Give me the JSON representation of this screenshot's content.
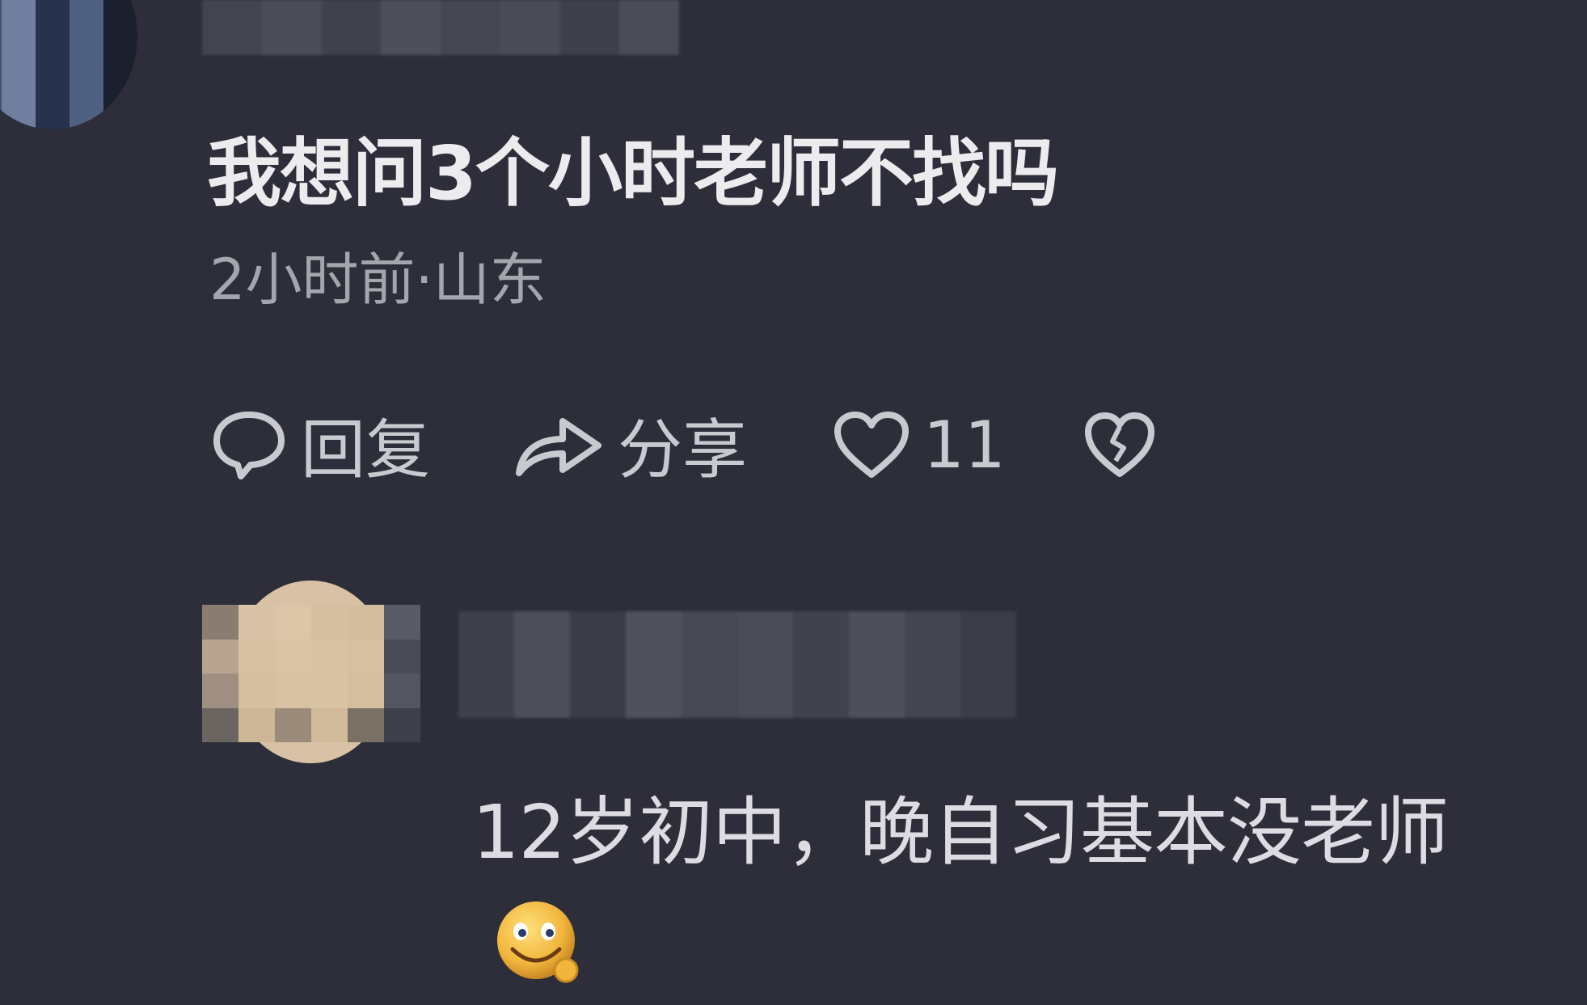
{
  "comment_1": {
    "text": "我想问3个小时老师不找吗",
    "meta": "2小时前·山东",
    "actions": {
      "reply_label": "回复",
      "share_label": "分享",
      "like_count": "11"
    }
  },
  "comment_2": {
    "text": "12岁初中，晚自习基本没老师",
    "emoji": "smiling-emoji"
  },
  "icons": {
    "reply": "comment-bubble-icon",
    "share": "share-arrow-icon",
    "like": "heart-icon",
    "dislike": "broken-heart-icon"
  },
  "colors": {
    "background": "#2d2e39",
    "primary_text": "#ececef",
    "secondary_text": "#a5a6ad",
    "icon": "#c9cad0"
  }
}
